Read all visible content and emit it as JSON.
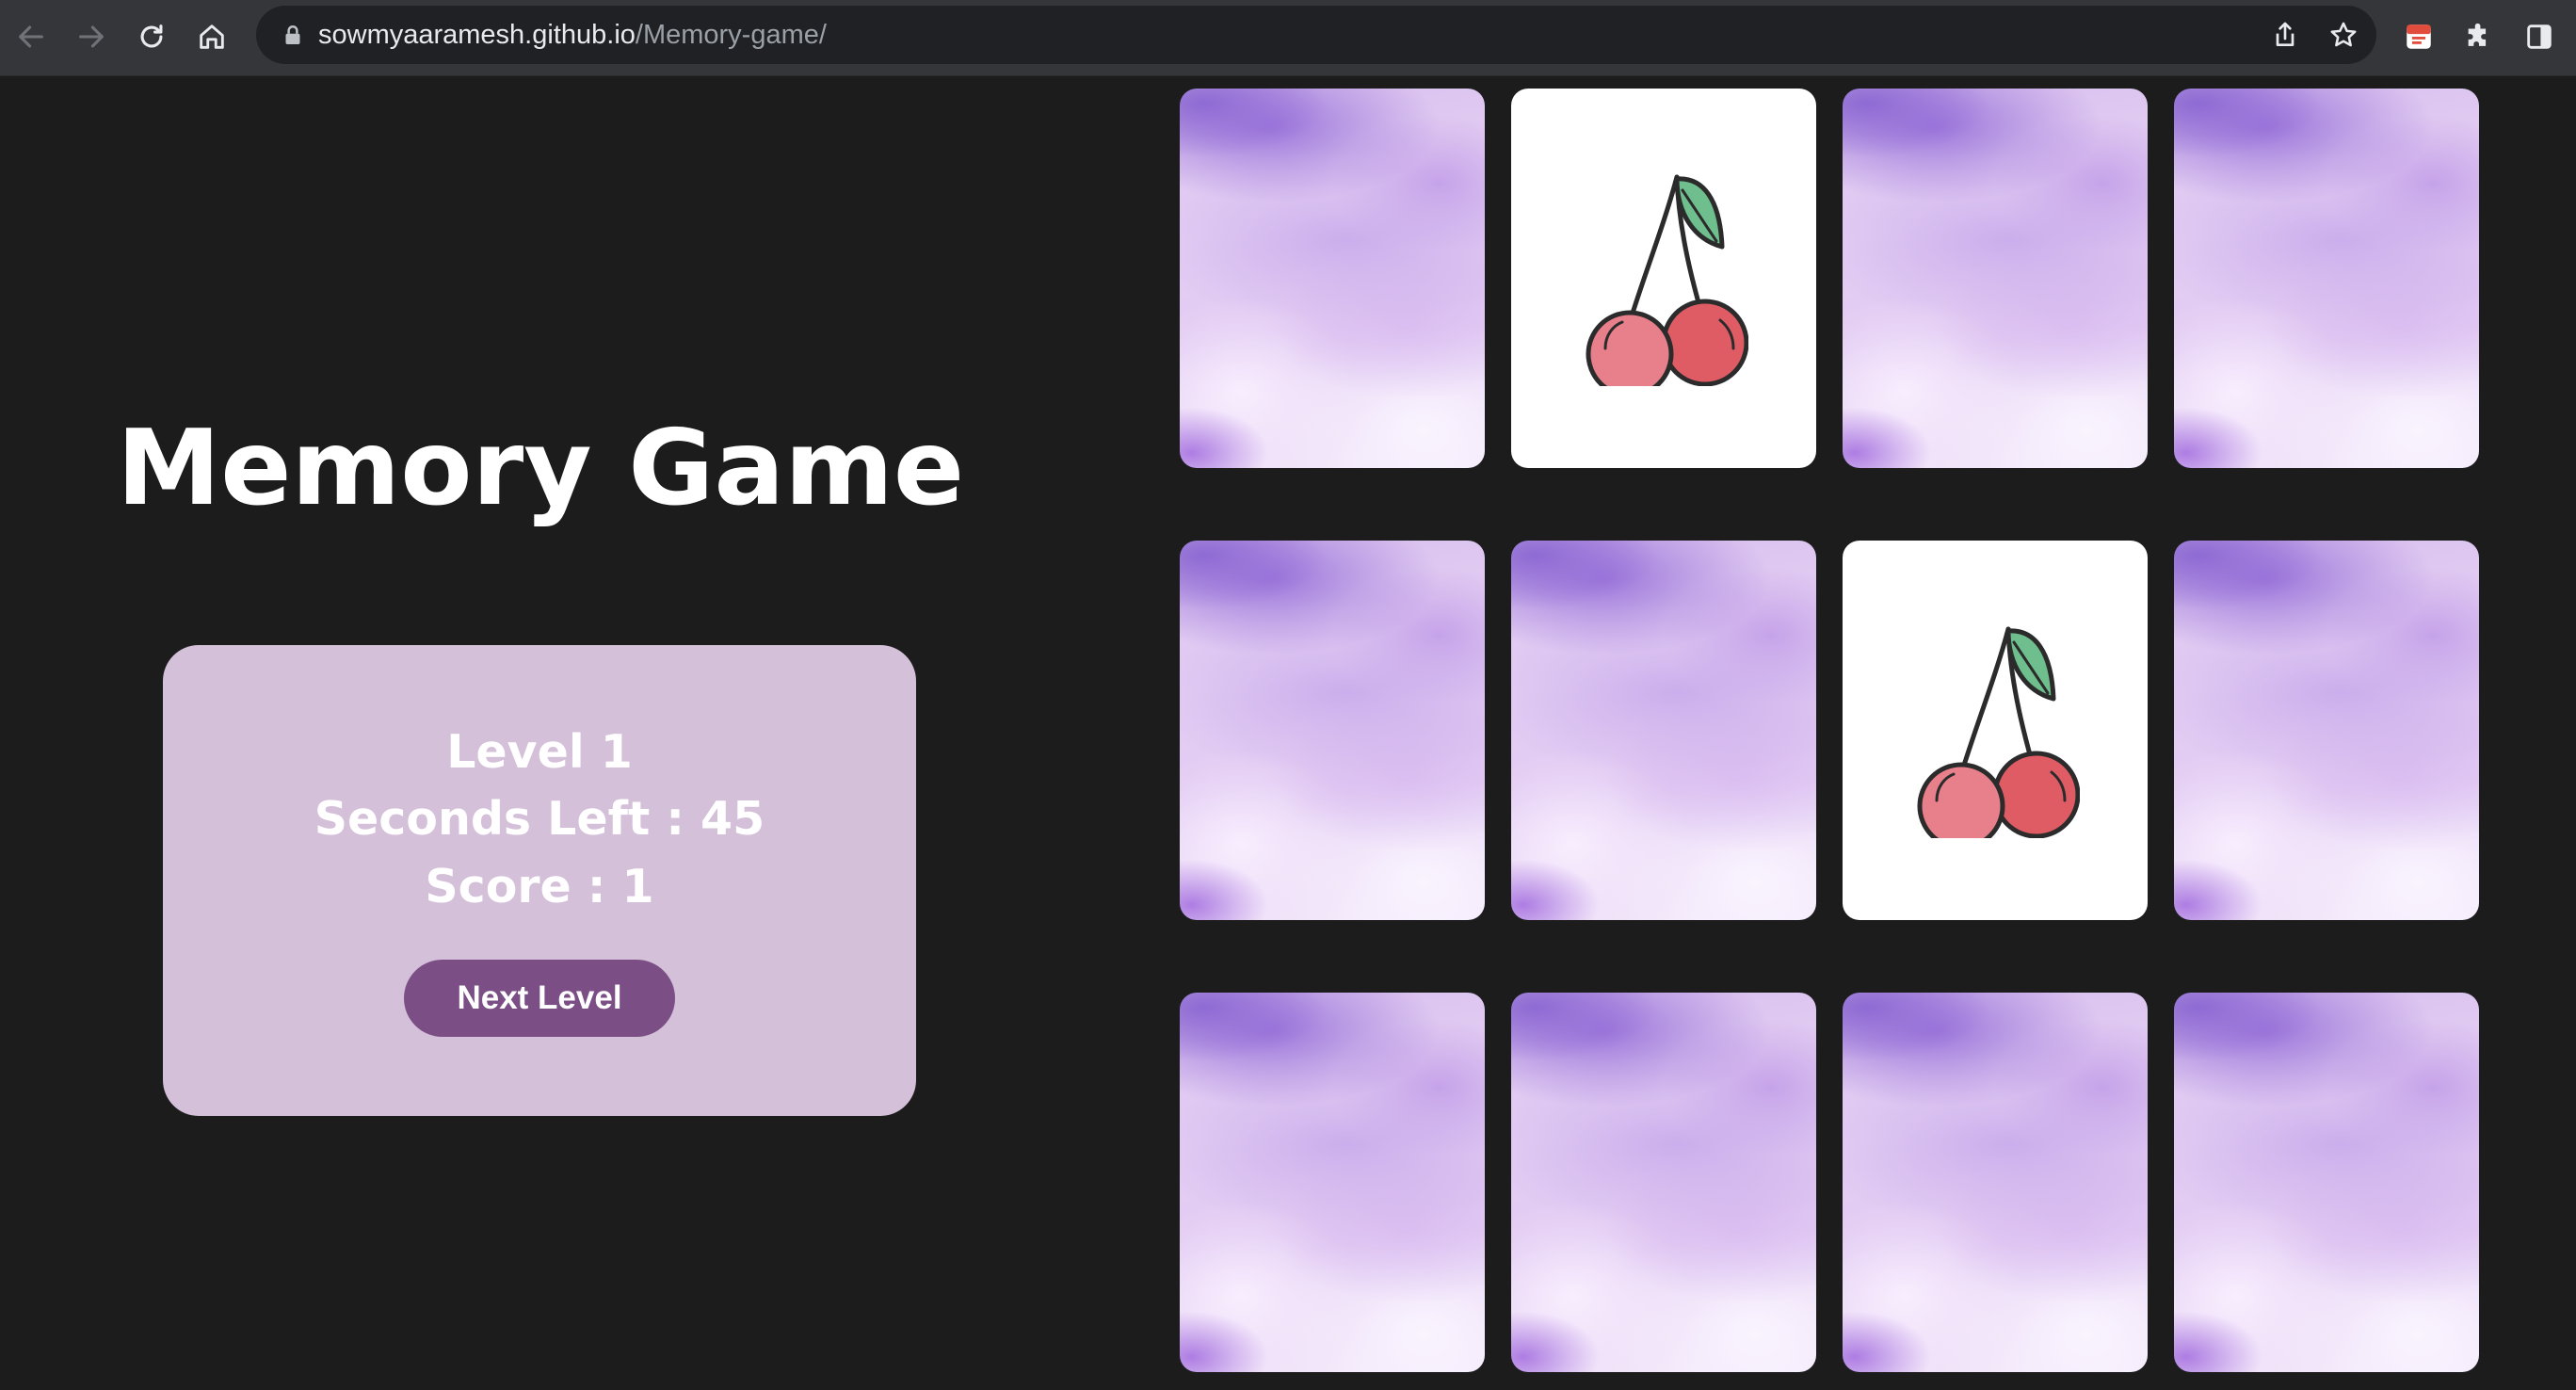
{
  "browser": {
    "url_host": "sowmyaaramesh.github.io",
    "url_path": "/Memory-game/",
    "icons": {
      "back": "back-arrow-icon",
      "forward": "forward-arrow-icon",
      "reload": "reload-icon",
      "home": "home-icon",
      "lock": "lock-icon",
      "share": "share-icon",
      "bookmark": "star-icon",
      "extension_pdf": "pdf-extension-icon",
      "extensions": "puzzle-icon",
      "side_panel": "side-panel-icon"
    }
  },
  "game": {
    "title": "Memory Game",
    "level_text": "Level 1",
    "seconds_text": "Seconds Left : 45",
    "score_text": "Score : 1",
    "next_level_label": "Next Level",
    "colors": {
      "background": "#1c1c1d",
      "panel": "#d4c0d9",
      "button": "#7b4e86",
      "card_back": "#e0c8f2"
    },
    "grid": {
      "rows": 3,
      "columns": 4,
      "cards": [
        {
          "state": "face-down"
        },
        {
          "state": "face-up",
          "symbol": "cherry-icon"
        },
        {
          "state": "face-down"
        },
        {
          "state": "face-down"
        },
        {
          "state": "face-down"
        },
        {
          "state": "face-down"
        },
        {
          "state": "face-up",
          "symbol": "cherry-icon"
        },
        {
          "state": "face-down"
        },
        {
          "state": "face-down"
        },
        {
          "state": "face-down"
        },
        {
          "state": "face-down"
        },
        {
          "state": "face-down"
        }
      ]
    }
  }
}
